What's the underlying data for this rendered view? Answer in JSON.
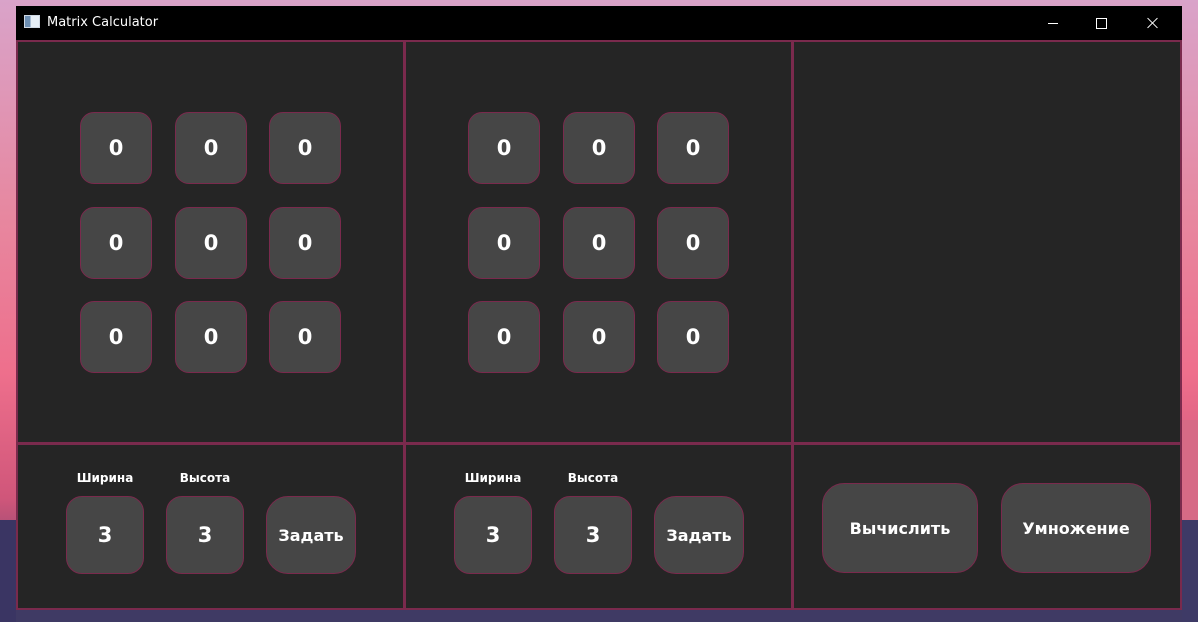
{
  "window": {
    "title": "Matrix Calculator"
  },
  "matrix_a": {
    "cells": [
      [
        "0",
        "0",
        "0"
      ],
      [
        "0",
        "0",
        "0"
      ],
      [
        "0",
        "0",
        "0"
      ]
    ],
    "width_label": "Ширина",
    "height_label": "Высота",
    "width_value": "3",
    "height_value": "3",
    "set_label": "Задать"
  },
  "matrix_b": {
    "cells": [
      [
        "0",
        "0",
        "0"
      ],
      [
        "0",
        "0",
        "0"
      ],
      [
        "0",
        "0",
        "0"
      ]
    ],
    "width_label": "Ширина",
    "height_label": "Высота",
    "width_value": "3",
    "height_value": "3",
    "set_label": "Задать"
  },
  "actions": {
    "calculate_label": "Вычислить",
    "multiply_label": "Умножение"
  },
  "colors": {
    "panel_bg": "#252525",
    "cell_bg": "#464646",
    "border": "#7a2a4d",
    "titlebar": "#000000",
    "text": "#ffffff"
  },
  "icons": {
    "app": "app-window-icon",
    "minimize": "minimize-icon",
    "maximize": "maximize-icon",
    "close": "close-icon"
  }
}
